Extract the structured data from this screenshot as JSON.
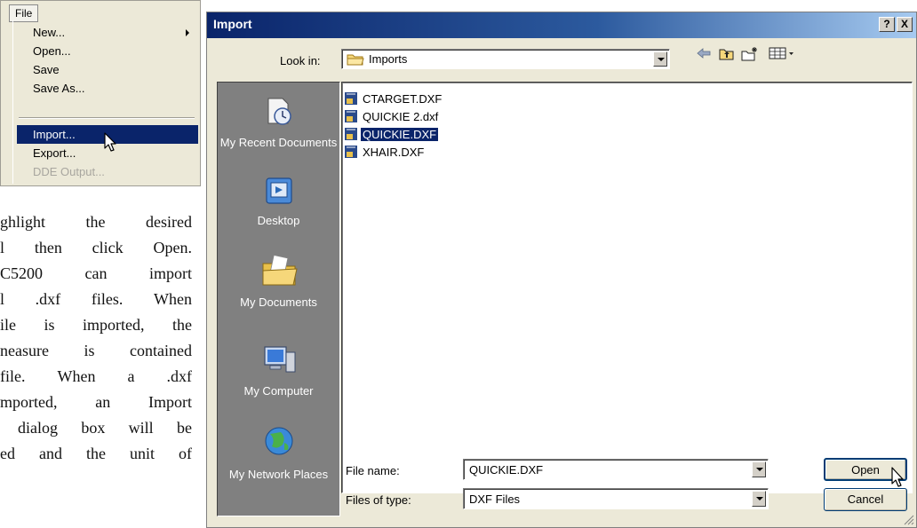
{
  "menu": {
    "title": "File",
    "items": [
      {
        "label": "New...",
        "state": "normal",
        "submenu": true
      },
      {
        "label": "Open...",
        "state": "normal"
      },
      {
        "label": "Save",
        "state": "normal"
      },
      {
        "label": "Save As...",
        "state": "normal"
      },
      {
        "label": "Import...",
        "state": "highlighted"
      },
      {
        "label": "Export...",
        "state": "normal"
      },
      {
        "label": "DDE Output...",
        "state": "disabled"
      }
    ]
  },
  "body_text": {
    "lines": [
      [
        "ghlight",
        "the",
        "desired"
      ],
      [
        "l",
        "then",
        "click",
        "Open."
      ],
      [
        "C5200",
        "can",
        "import"
      ],
      [
        "l",
        ".dxf",
        "files.",
        "When"
      ],
      [
        "ile",
        "is",
        "imported,",
        "the"
      ],
      [
        "neasure",
        "is",
        "contained"
      ],
      [
        "file.",
        "When",
        "a",
        ".dxf"
      ],
      [
        "mported,",
        "an",
        "Import"
      ],
      [
        "dialog",
        "box",
        "will",
        "be"
      ],
      [
        "ed",
        "and",
        "the",
        "unit",
        "of"
      ]
    ]
  },
  "dialog": {
    "title": "Import",
    "help_button": "?",
    "close_button": "X",
    "look_in_label": "Look in:",
    "look_in_value": "Imports",
    "places": [
      {
        "label": "My Recent Documents",
        "icon": "recent-documents-icon"
      },
      {
        "label": "Desktop",
        "icon": "desktop-icon"
      },
      {
        "label": "My Documents",
        "icon": "my-documents-icon"
      },
      {
        "label": "My Computer",
        "icon": "my-computer-icon"
      },
      {
        "label": "My Network Places",
        "icon": "network-places-icon"
      }
    ],
    "files": [
      {
        "name": "CTARGET.DXF",
        "selected": false
      },
      {
        "name": "QUICKIE 2.dxf",
        "selected": false
      },
      {
        "name": "QUICKIE.DXF",
        "selected": true
      },
      {
        "name": "XHAIR.DXF",
        "selected": false
      }
    ],
    "file_name_label": "File name:",
    "file_name_value": "QUICKIE.DXF",
    "files_of_type_label": "Files of type:",
    "files_of_type_value": "DXF Files",
    "open_button": "Open",
    "cancel_button": "Cancel"
  },
  "colors": {
    "highlight": "#0a246a",
    "dialog_face": "#ece9d8",
    "places_bar": "#808080"
  }
}
